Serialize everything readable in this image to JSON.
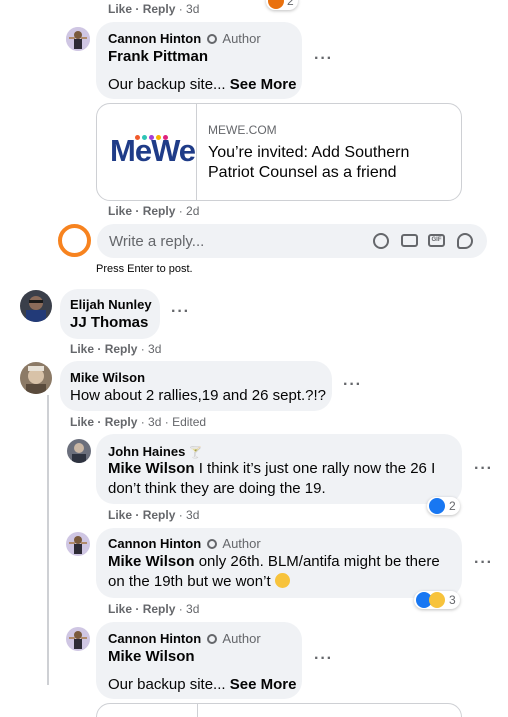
{
  "top_actions": {
    "like": "Like",
    "reply": "Reply",
    "time": "3d",
    "react_count": "2"
  },
  "c1": {
    "name": "Cannon Hinton",
    "author": "Author",
    "mention": "Frank Pittman",
    "text": "Our backup site...",
    "see_more": "See More"
  },
  "link_card": {
    "domain": "MEWE.COM",
    "title": "You’re invited: Add Southern Patriot Counsel as a friend",
    "logo": "MeWe"
  },
  "c1_actions": {
    "like": "Like",
    "reply": "Reply",
    "time": "2d"
  },
  "reply_box": {
    "placeholder": "Write a reply...",
    "hint": "Press Enter to post.",
    "gif_label": "GIF"
  },
  "c2": {
    "name": "Elijah Nunley",
    "mention": "JJ Thomas",
    "like": "Like",
    "reply": "Reply",
    "time": "3d"
  },
  "c3": {
    "name": "Mike Wilson",
    "text": "How about 2 rallies,19 and 26 sept.?!?",
    "like": "Like",
    "reply": "Reply",
    "time": "3d",
    "edited": "Edited"
  },
  "c4": {
    "name": "John Haines",
    "mention": "Mike Wilson",
    "text": "I think it’s just one rally now the 26 I don’t think they are doing the 19.",
    "like": "Like",
    "reply": "Reply",
    "time": "3d",
    "react_count": "2"
  },
  "c5": {
    "name": "Cannon Hinton",
    "author": "Author",
    "mention": "Mike Wilson",
    "text": "only 26th. BLM/antifa might be there on the 19th but we won’t",
    "like": "Like",
    "reply": "Reply",
    "time": "3d",
    "react_count": "3"
  },
  "c6": {
    "name": "Cannon Hinton",
    "author": "Author",
    "mention": "Mike Wilson",
    "text": "Our backup site...",
    "see_more": "See More"
  },
  "colors": {
    "bubble": "#f0f2f5",
    "meta": "#65676b",
    "like_blue": "#1877f2",
    "orange_ring": "#f7831f",
    "mewe_blue": "#1f3c88"
  }
}
